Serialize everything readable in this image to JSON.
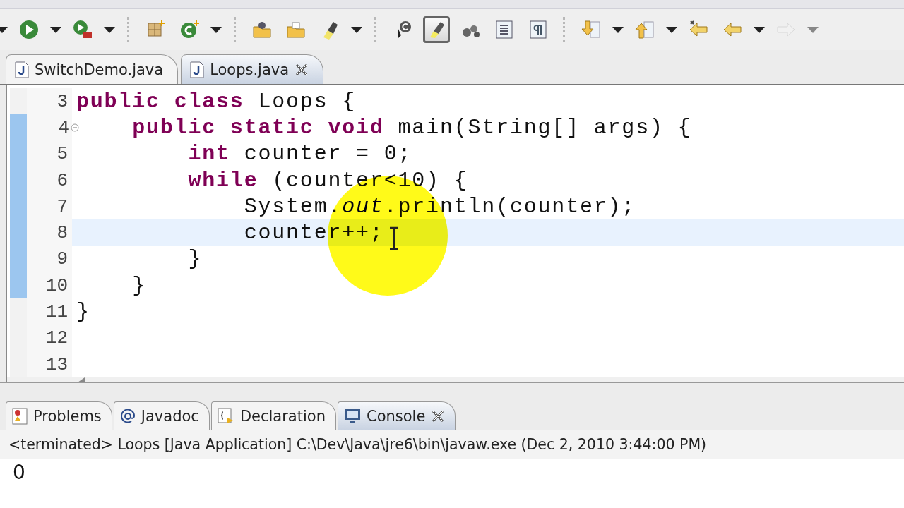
{
  "toolbar": {
    "items": [
      {
        "kind": "dropdown",
        "disabled": false
      },
      {
        "kind": "button",
        "selected": false,
        "disabled": false
      },
      {
        "kind": "dropdown",
        "disabled": false
      },
      {
        "kind": "button",
        "selected": false,
        "disabled": false
      },
      {
        "kind": "dropdown",
        "disabled": false
      },
      {
        "kind": "separator"
      },
      {
        "kind": "button",
        "selected": false,
        "disabled": false
      },
      {
        "kind": "button",
        "selected": false,
        "disabled": false
      },
      {
        "kind": "dropdown",
        "disabled": false
      },
      {
        "kind": "separator"
      },
      {
        "kind": "button",
        "selected": false,
        "disabled": false
      },
      {
        "kind": "button",
        "selected": false,
        "disabled": false
      },
      {
        "kind": "button",
        "selected": false,
        "disabled": false
      },
      {
        "kind": "dropdown",
        "disabled": false
      },
      {
        "kind": "separator"
      },
      {
        "kind": "button",
        "selected": false,
        "disabled": false
      },
      {
        "kind": "button",
        "selected": true,
        "disabled": false
      },
      {
        "kind": "button",
        "selected": false,
        "disabled": false
      },
      {
        "kind": "button",
        "selected": false,
        "disabled": false
      },
      {
        "kind": "button",
        "selected": false,
        "disabled": false
      },
      {
        "kind": "separator"
      },
      {
        "kind": "button",
        "selected": false,
        "disabled": false
      },
      {
        "kind": "dropdown",
        "disabled": false
      },
      {
        "kind": "button",
        "selected": false,
        "disabled": false
      },
      {
        "kind": "dropdown",
        "disabled": false
      },
      {
        "kind": "button",
        "selected": false,
        "disabled": false
      },
      {
        "kind": "button",
        "selected": false,
        "disabled": false
      },
      {
        "kind": "dropdown",
        "disabled": false
      },
      {
        "kind": "button",
        "selected": false,
        "disabled": true
      },
      {
        "kind": "dropdown",
        "disabled": true
      }
    ]
  },
  "editor": {
    "tabs": [
      {
        "label": "SwitchDemo.java",
        "selected": false,
        "closable": false
      },
      {
        "label": "Loops.java",
        "selected": true,
        "closable": true
      }
    ],
    "lines": [
      {
        "number": "3",
        "code": "**public** **class** Loops {",
        "current": false,
        "in_range": false,
        "foldable": false
      },
      {
        "number": "4",
        "code": "    **public** **static** **void** main(String[] args) {",
        "current": false,
        "in_range": true,
        "foldable": true
      },
      {
        "number": "5",
        "code": "        **int** counter = 0;",
        "current": false,
        "in_range": true,
        "foldable": false
      },
      {
        "number": "6",
        "code": "        **while** (counter<10) {",
        "current": false,
        "in_range": true,
        "foldable": false
      },
      {
        "number": "7",
        "code": "            System.*out*.println(counter);",
        "current": false,
        "in_range": true,
        "foldable": false
      },
      {
        "number": "8",
        "code": "            counter++;",
        "current": true,
        "in_range": true,
        "foldable": false
      },
      {
        "number": "9",
        "code": "        }",
        "current": false,
        "in_range": true,
        "foldable": false
      },
      {
        "number": "10",
        "code": "    }",
        "current": false,
        "in_range": true,
        "foldable": false
      },
      {
        "number": "11",
        "code": "}",
        "current": false,
        "in_range": false,
        "foldable": false
      },
      {
        "number": "12",
        "current": false,
        "in_range": false,
        "foldable": false
      },
      {
        "number": "13",
        "current": false,
        "in_range": false,
        "foldable": false
      }
    ],
    "mouse_highlight": true
  },
  "console": {
    "tabs": [
      {
        "label": "Problems",
        "selected": false,
        "closable": false
      },
      {
        "label": "Javadoc",
        "selected": false,
        "closable": false
      },
      {
        "label": "Declaration",
        "selected": false,
        "closable": false
      },
      {
        "label": "Console",
        "selected": true,
        "closable": true
      }
    ],
    "header": "<terminated> Loops [Java Application] C:\\Dev\\Java\\jre6\\bin\\javaw.exe (Dec 2, 2010 3:44:00 PM)",
    "output": [
      "0"
    ]
  }
}
